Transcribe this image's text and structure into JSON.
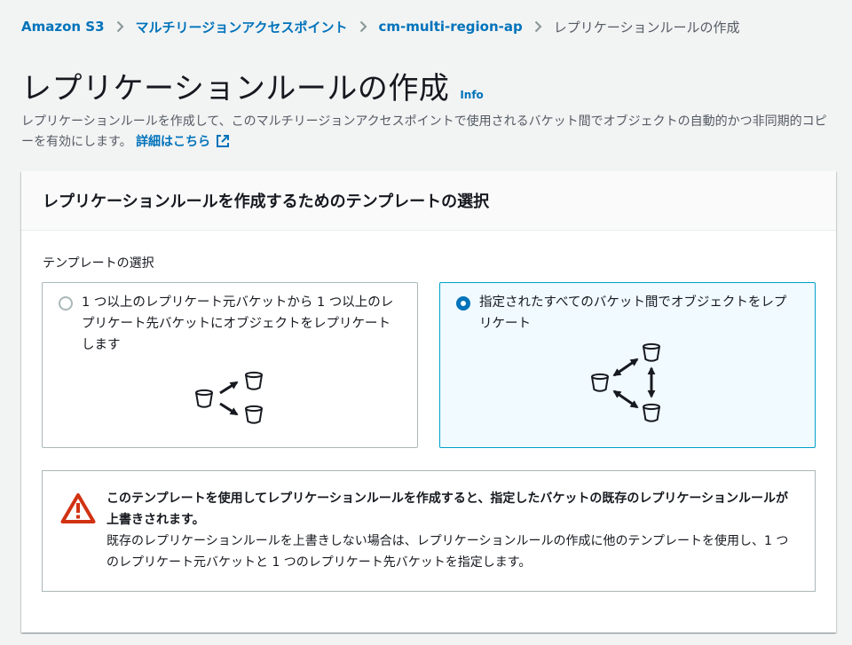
{
  "breadcrumb": {
    "items": [
      "Amazon S3",
      "マルチリージョンアクセスポイント",
      "cm-multi-region-ap"
    ],
    "current": "レプリケーションルールの作成"
  },
  "page": {
    "title": "レプリケーションルールの作成",
    "info_label": "Info",
    "description": "レプリケーションルールを作成して、このマルチリージョンアクセスポイントで使用されるバケット間でオブジェクトの自動的かつ非同期的コピーを有効にします。",
    "details_link": "詳細はこちら"
  },
  "template_panel": {
    "title": "レプリケーションルールを作成するためのテンプレートの選択",
    "field_label": "テンプレートの選択",
    "options": [
      {
        "label": "1 つ以上のレプリケート元バケットから 1 つ以上のレプリケート先バケットにオブジェクトをレプリケートします",
        "selected": false,
        "icon": "one-to-many-buckets-icon"
      },
      {
        "label": "指定されたすべてのバケット間でオブジェクトをレプリケート",
        "selected": true,
        "icon": "bidirectional-buckets-icon"
      }
    ]
  },
  "alert": {
    "type": "warning",
    "icon": "warning-icon",
    "title": "このテンプレートを使用してレプリケーションルールを作成すると、指定したバケットの既存のレプリケーションルールが上書きされます。",
    "body": "既存のレプリケーションルールを上書きしない場合は、レプリケーションルールの作成に他のテンプレートを使用し、1 つのレプリケート元バケットと 1 つのレプリケート先バケットを指定します。"
  },
  "colors": {
    "link": "#0073bb",
    "selected_border": "#00a1c9",
    "selected_bg": "#f1faff",
    "warning": "#d13212",
    "page_bg": "#f2f3f3"
  }
}
